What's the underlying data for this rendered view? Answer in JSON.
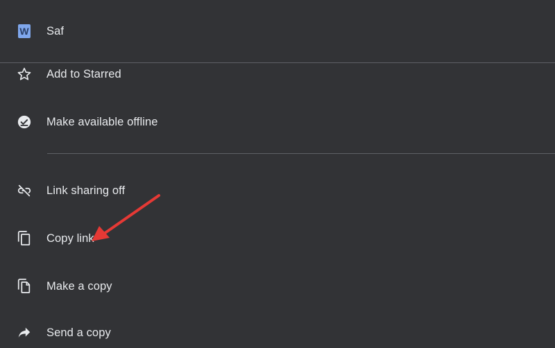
{
  "file": {
    "icon": "word-doc-icon",
    "icon_letter": "W",
    "name": "Saf"
  },
  "menu": {
    "items": [
      {
        "label": "Add to Starred",
        "icon": "star-outline-icon"
      },
      {
        "label": "Make available offline",
        "icon": "offline-check-icon"
      },
      {
        "label": "Link sharing off",
        "icon": "link-off-icon"
      },
      {
        "label": "Copy link",
        "icon": "copy-icon"
      },
      {
        "label": "Make a copy",
        "icon": "file-copy-icon"
      },
      {
        "label": "Send a copy",
        "icon": "send-icon"
      }
    ]
  },
  "annotation": {
    "type": "red-arrow",
    "color": "#e53935",
    "points_to": "Copy link"
  },
  "colors": {
    "background": "#323336",
    "text": "#e8eaed",
    "divider": "#5f6166",
    "icon": "#e8eaed",
    "word_icon": "#7fa7ec"
  }
}
